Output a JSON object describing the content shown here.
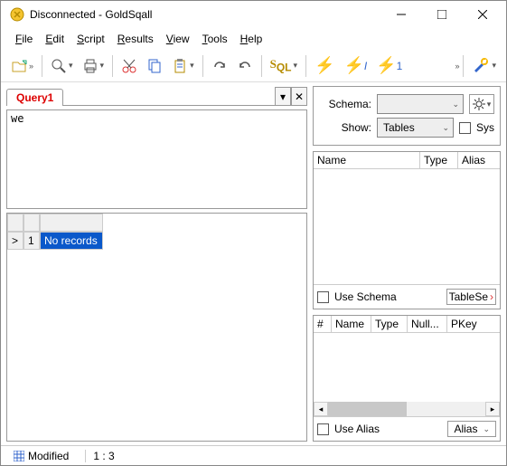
{
  "window": {
    "title": "Disconnected - GoldSqall"
  },
  "menu": [
    "File",
    "Edit",
    "Script",
    "Results",
    "View",
    "Tools",
    "Help"
  ],
  "menu_ul": [
    "F",
    "E",
    "S",
    "R",
    "V",
    "T",
    "H"
  ],
  "tabs": {
    "active": "Query1"
  },
  "editor": {
    "content": "we"
  },
  "grid": {
    "rownum": "1",
    "message": "No records",
    "marker": ">"
  },
  "statusbar": {
    "state": "Modified",
    "pos": "1 : 3"
  },
  "schema_panel": {
    "schema_label": "Schema:",
    "show_label": "Show:",
    "show_value": "Tables",
    "sys_label": "Sys",
    "columns": [
      "Name",
      "Type",
      "Alias"
    ],
    "use_schema_label": "Use Schema",
    "tablese_label": "TableSe"
  },
  "columns_panel": {
    "columns": [
      "#",
      "Name",
      "Type",
      "Null...",
      "PKey"
    ],
    "use_alias_label": "Use Alias",
    "alias_label": "Alias"
  },
  "toolbar": {
    "bolt_i": "I",
    "bolt_1": "1"
  }
}
